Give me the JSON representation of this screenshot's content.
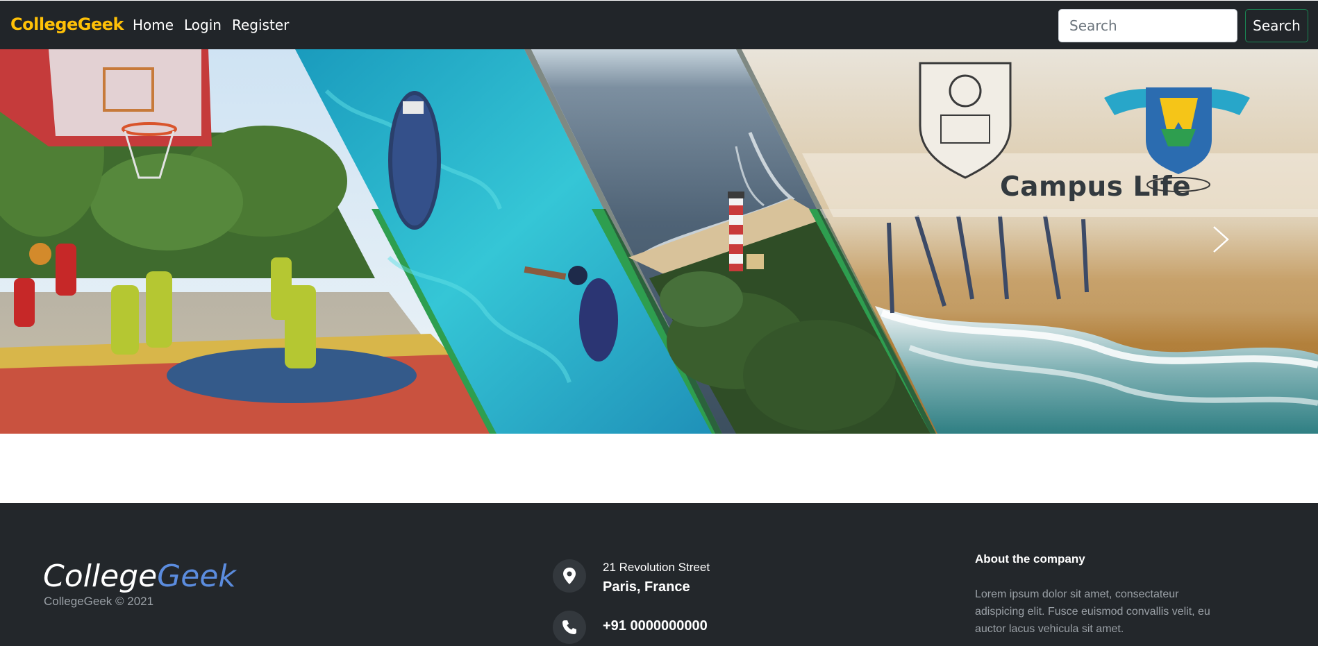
{
  "navbar": {
    "brand": "CollegeGeek",
    "links": [
      "Home",
      "Login",
      "Register"
    ],
    "search_placeholder": "Search",
    "search_button": "Search"
  },
  "hero": {
    "title": "Campus Life"
  },
  "footer": {
    "logo_part1": "College",
    "logo_part2": "Geek",
    "copyright": "CollegeGeek © 2021",
    "address_line1": "21 Revolution Street",
    "address_line2": "Paris, France",
    "phone": "+91 0000000000",
    "about_title": "About the company",
    "about_text": "Lorem ipsum dolor sit amet, consectateur adispicing elit. Fusce euismod convallis velit, eu auctor lacus vehicula sit amet."
  },
  "colors": {
    "navbar_bg": "#212529",
    "brand": "#ffc107",
    "search_button_border": "#198754",
    "footer_bg": "#23272b",
    "logo_accent": "#5b8cde",
    "stripe_green": "#2e9e4f"
  },
  "icons": [
    "location-pin-icon",
    "phone-icon",
    "chevron-right-icon"
  ]
}
